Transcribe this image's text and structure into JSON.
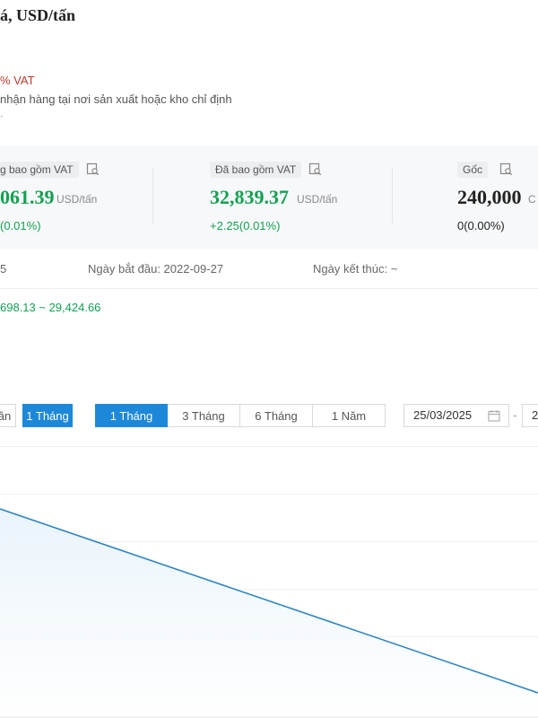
{
  "page": {
    "title": "á, USD/tấn",
    "vat_note": "% VAT",
    "delivery_note": "nhận hàng tại nơi sản xuất hoặc kho chỉ định",
    "small_mark": "·"
  },
  "stats": [
    {
      "tag": "g bao gồm VAT",
      "value": "061.39",
      "unit": "USD/tấn",
      "change": "(0.01%)",
      "trend": "up"
    },
    {
      "tag": "Đã bao gồm VAT",
      "value": "32,839.37",
      "unit": "USD/tấn",
      "change": "+2.25(0.01%)",
      "trend": "up"
    },
    {
      "tag": "Gốc",
      "value": "240,000",
      "unit": "C",
      "change": "0(0.00%)",
      "trend": "flat"
    }
  ],
  "dates": {
    "left_fragment": "5",
    "start": "Ngày bắt đầu: 2022-09-27",
    "end": "Ngày kết thúc: ~"
  },
  "price_range": "698.13 ~ 29,424.66",
  "controls": {
    "left_btn": "ần",
    "left_active": "1 Tháng",
    "periods": [
      "1 Tháng",
      "3 Tháng",
      "6 Tháng",
      "1 Năm"
    ],
    "active_period": 0,
    "date_from": "25/03/2025",
    "date_sep": "-",
    "date_to": "2"
  },
  "colors": {
    "accent": "#1e88d8",
    "up": "#12a150",
    "line": "#2f86c3"
  },
  "icons": {
    "tag": "search-doc-icon",
    "date": "calendar-icon"
  },
  "chart_data": {
    "type": "area",
    "series": [
      {
        "values": [
          1.0,
          0.0
        ]
      }
    ],
    "grid": true,
    "xlabel": "",
    "ylabel": ""
  }
}
